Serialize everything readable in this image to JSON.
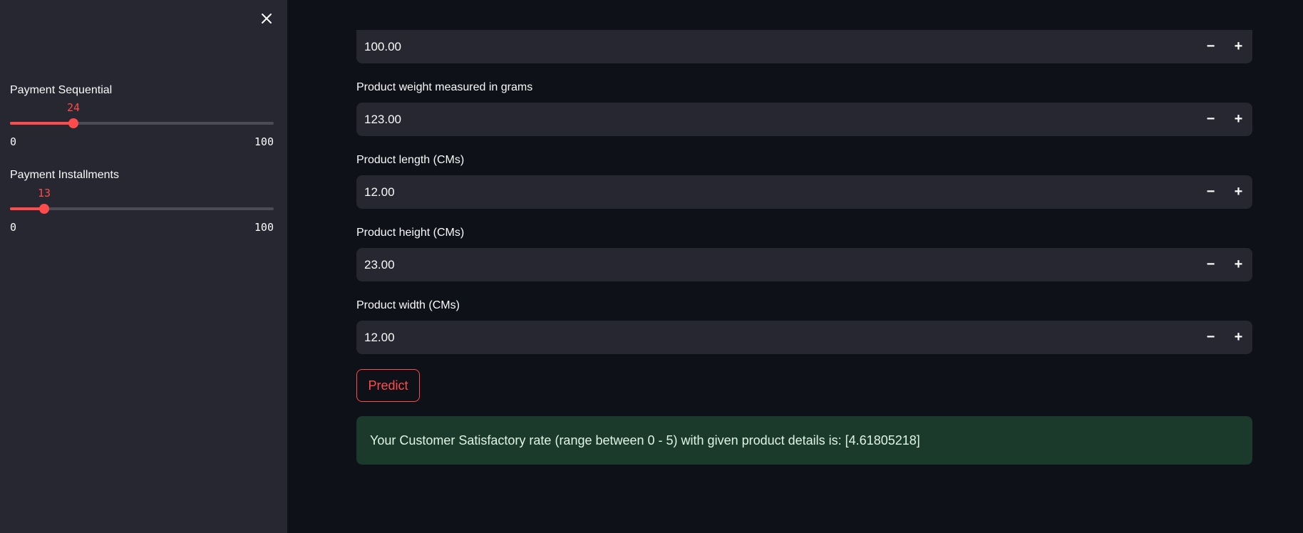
{
  "sidebar": {
    "sliders": [
      {
        "label": "Payment Sequential",
        "value": "24",
        "min": "0",
        "max": "100",
        "fraction": 0.24
      },
      {
        "label": "Payment Installments",
        "value": "13",
        "min": "0",
        "max": "100",
        "fraction": 0.13
      }
    ]
  },
  "main": {
    "fields": [
      {
        "label": "",
        "value": "100.00"
      },
      {
        "label": "Product weight measured in grams",
        "value": "123.00"
      },
      {
        "label": "Product length (CMs)",
        "value": "12.00"
      },
      {
        "label": "Product height (CMs)",
        "value": "23.00"
      },
      {
        "label": "Product width (CMs)",
        "value": "12.00"
      }
    ],
    "step_minus": "−",
    "step_plus": "+",
    "predict_label": "Predict",
    "result_text": "Your Customer Satisfactory rate (range between 0 - 5) with given product details is: [4.61805218]"
  },
  "colors": {
    "accent": "#ff4b4b",
    "sidebar_bg": "#262730",
    "main_bg": "#0e1117",
    "success_bg": "#1b3a2c"
  },
  "icons": {
    "close": "close-icon"
  }
}
